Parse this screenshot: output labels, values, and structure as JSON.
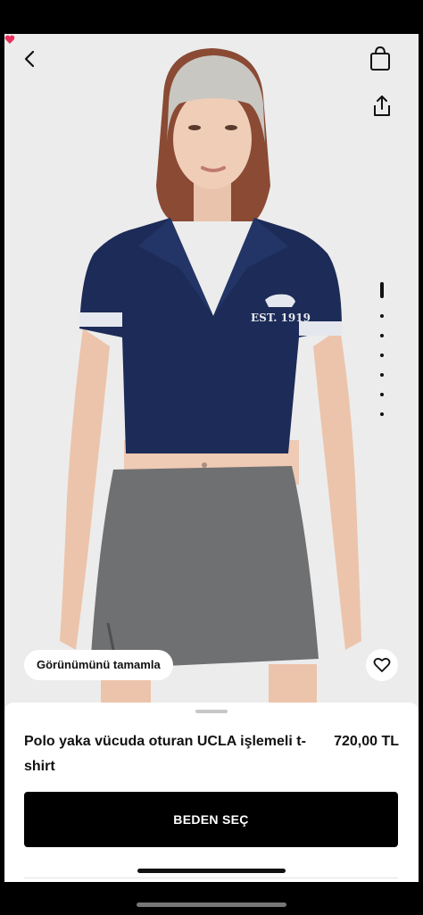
{
  "header": {
    "back_icon": "chevron-left-icon",
    "cart_icon": "shopping-bag-icon",
    "cart_badge_color": "#e8315b",
    "share_icon": "share-icon"
  },
  "gallery": {
    "image_count": 7,
    "active_index": 0,
    "complete_look_label": "Görünümünü tamamla",
    "wishlist_icon": "heart-outline-icon"
  },
  "product": {
    "name": "Polo yaka vücuda oturan UCLA işlemeli t-shirt",
    "price": "720,00 TL",
    "print_text": "EST. 1919",
    "colors": {
      "top": "#1c2b57",
      "skirt": "#6f7072",
      "headband": "#c9c7c2",
      "background": "#ececec"
    }
  },
  "actions": {
    "select_size_label": "BEDEN SEÇ"
  }
}
